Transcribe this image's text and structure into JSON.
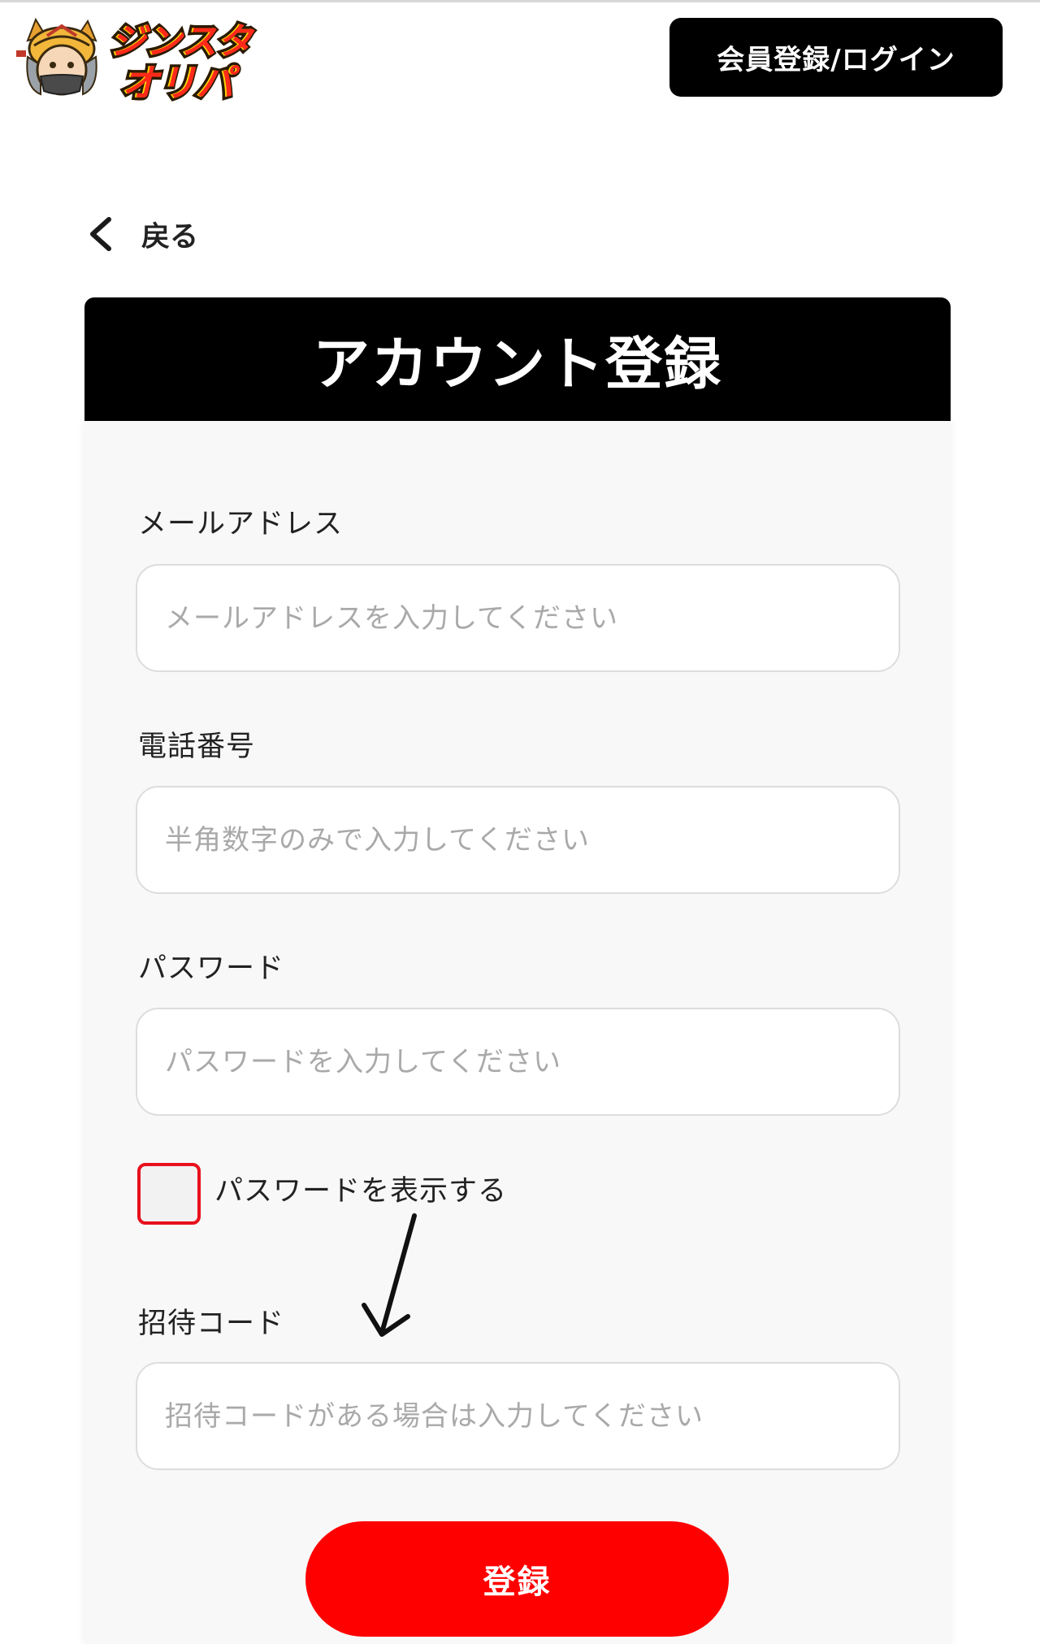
{
  "header": {
    "logo_text_line1": "ジンスタ",
    "logo_text_line2": "オリパ",
    "login_button_label": "会員登録/ログイン"
  },
  "nav": {
    "back_label": "戻る"
  },
  "form": {
    "title": "アカウント登録",
    "fields": [
      {
        "label": "メールアドレス",
        "placeholder": "メールアドレスを入力してください",
        "value": ""
      },
      {
        "label": "電話番号",
        "placeholder": "半角数字のみで入力してください",
        "value": ""
      },
      {
        "label": "パスワード",
        "placeholder": "パスワードを入力してください",
        "value": ""
      },
      {
        "label": "招待コード",
        "placeholder": "招待コードがある場合は入力してください",
        "value": ""
      }
    ],
    "show_password_label": "パスワードを表示する",
    "show_password_checked": false,
    "submit_label": "登録"
  },
  "colors": {
    "accent_red": "#ff0000",
    "checkbox_border": "#e8101c",
    "header_black": "#000000"
  },
  "icons": {
    "back": "chevron-left-icon",
    "annotation": "arrow-down-icon"
  }
}
